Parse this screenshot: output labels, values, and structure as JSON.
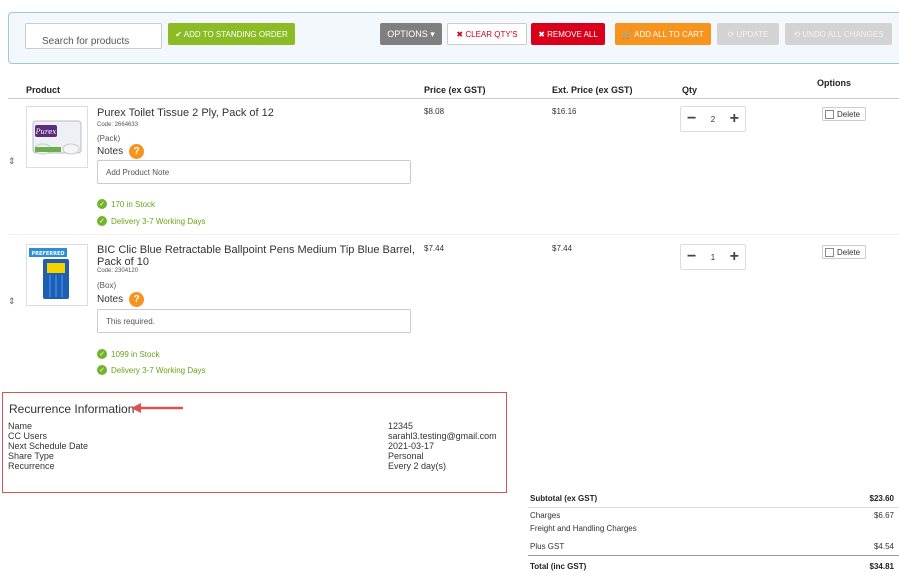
{
  "toolbar": {
    "search_placeholder": "Search for products",
    "add_standing_order": "✔ ADD TO STANDING ORDER",
    "options": "OPTIONS ▾",
    "clear_qtys": "✖ CLEAR QTY'S",
    "remove_all": "✖ REMOVE ALL",
    "add_all_to_cart": "🛒 ADD ALL TO CART",
    "update": "⟳ UPDATE",
    "undo_all": "⟲ UNDO ALL CHANGES"
  },
  "columns": {
    "product": "Product",
    "price": "Price (ex GST)",
    "ext_price": "Ext. Price (ex GST)",
    "qty": "Qty",
    "options": "Options"
  },
  "products": [
    {
      "name": "Purex Toilet Tissue 2 Ply, Pack of 12",
      "code": "Code: 2664633",
      "pack": "(Pack)",
      "notes_label": "Notes",
      "note_placeholder": "Add Product Note",
      "note_value": "",
      "stock": "170 in Stock",
      "delivery": "Delivery 3-7 Working Days",
      "price": "$8.08",
      "ext_price": "$16.16",
      "qty": "2",
      "delete": "Delete",
      "thumb_brand": "Purex"
    },
    {
      "name": "BIC Clic Blue Retractable Ballpoint Pens Medium Tip Blue Barrel, Pack of 10",
      "code": "Code: 2304120",
      "pack": "(Box)",
      "notes_label": "Notes",
      "note_placeholder": "",
      "note_value": "This required.",
      "stock": "1099 in Stock",
      "delivery": "Delivery 3-7 Working Days",
      "price": "$7.44",
      "ext_price": "$7.44",
      "qty": "1",
      "delete": "Delete",
      "thumb_brand": "PREFERRED"
    }
  ],
  "recurrence": {
    "title": "Recurrence Information",
    "fields": [
      {
        "label": "Name",
        "value": "12345"
      },
      {
        "label": "CC Users",
        "value": "sarahl3.testing@gmail.com"
      },
      {
        "label": "Next Schedule Date",
        "value": "2021-03-17"
      },
      {
        "label": "Share Type",
        "value": "Personal"
      },
      {
        "label": "Recurrence",
        "value": "Every 2 day(s)"
      }
    ]
  },
  "summary": {
    "subtotal_label": "Subtotal (ex GST)",
    "subtotal_value": "$23.60",
    "charges_label": "Charges",
    "charges_value": "$6.67",
    "freight_label": "Freight and Handling Charges",
    "gst_label": "Plus GST",
    "gst_value": "$4.54",
    "total_label": "Total (inc GST)",
    "total_value": "$34.81"
  },
  "colors": {
    "green": "#8bbb25",
    "red": "#d9001b",
    "orange": "#f7941d",
    "grey": "#7f7f7f"
  }
}
